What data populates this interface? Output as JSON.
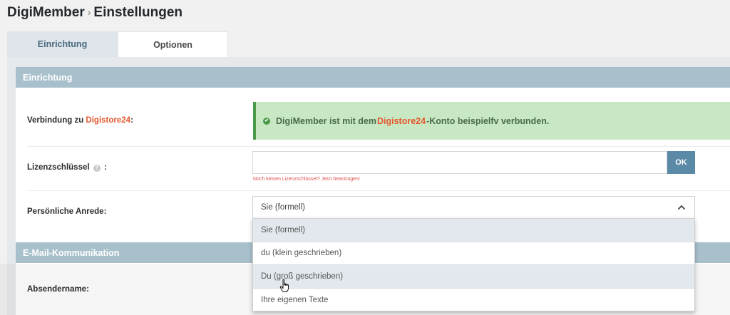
{
  "header": {
    "brand": "DigiMember",
    "separator": "›",
    "page": "Einstellungen"
  },
  "tabs": [
    {
      "label": "Einrichtung",
      "active": true
    },
    {
      "label": "Optionen",
      "active": false
    }
  ],
  "sections": {
    "setup": {
      "title": "Einrichtung"
    },
    "email": {
      "title": "E-Mail-Kommunikation"
    }
  },
  "connection": {
    "label_prefix": "Verbindung zu ",
    "label_highlight": "Digistore24",
    "label_suffix": ":",
    "alert_prefix": "DigiMember ist mit dem ",
    "alert_highlight": "Digistore24",
    "alert_suffix": "-Konto beispielfv verbunden."
  },
  "license": {
    "label": "Lizenzschlüssel",
    "help_icon": "question-circle-icon",
    "label_suffix": ":",
    "value": "",
    "ok_label": "OK",
    "hint": "Noch keinen Lizenzschlüssel? Jetzt beantragen!"
  },
  "salutation": {
    "label": "Persönliche Anrede:",
    "selected": "Sie (formell)",
    "options": [
      "Sie (formell)",
      "du (klein geschrieben)",
      "Du (groß geschrieben)",
      "Ihre eigenen Texte"
    ]
  },
  "sender": {
    "label": "Absendername:"
  },
  "colors": {
    "accent": "#5b8aa6",
    "highlight": "#e4572e",
    "success_bg": "#c7e8c3",
    "success_border": "#4a9a4a",
    "section_header": "#a8c0cc"
  }
}
